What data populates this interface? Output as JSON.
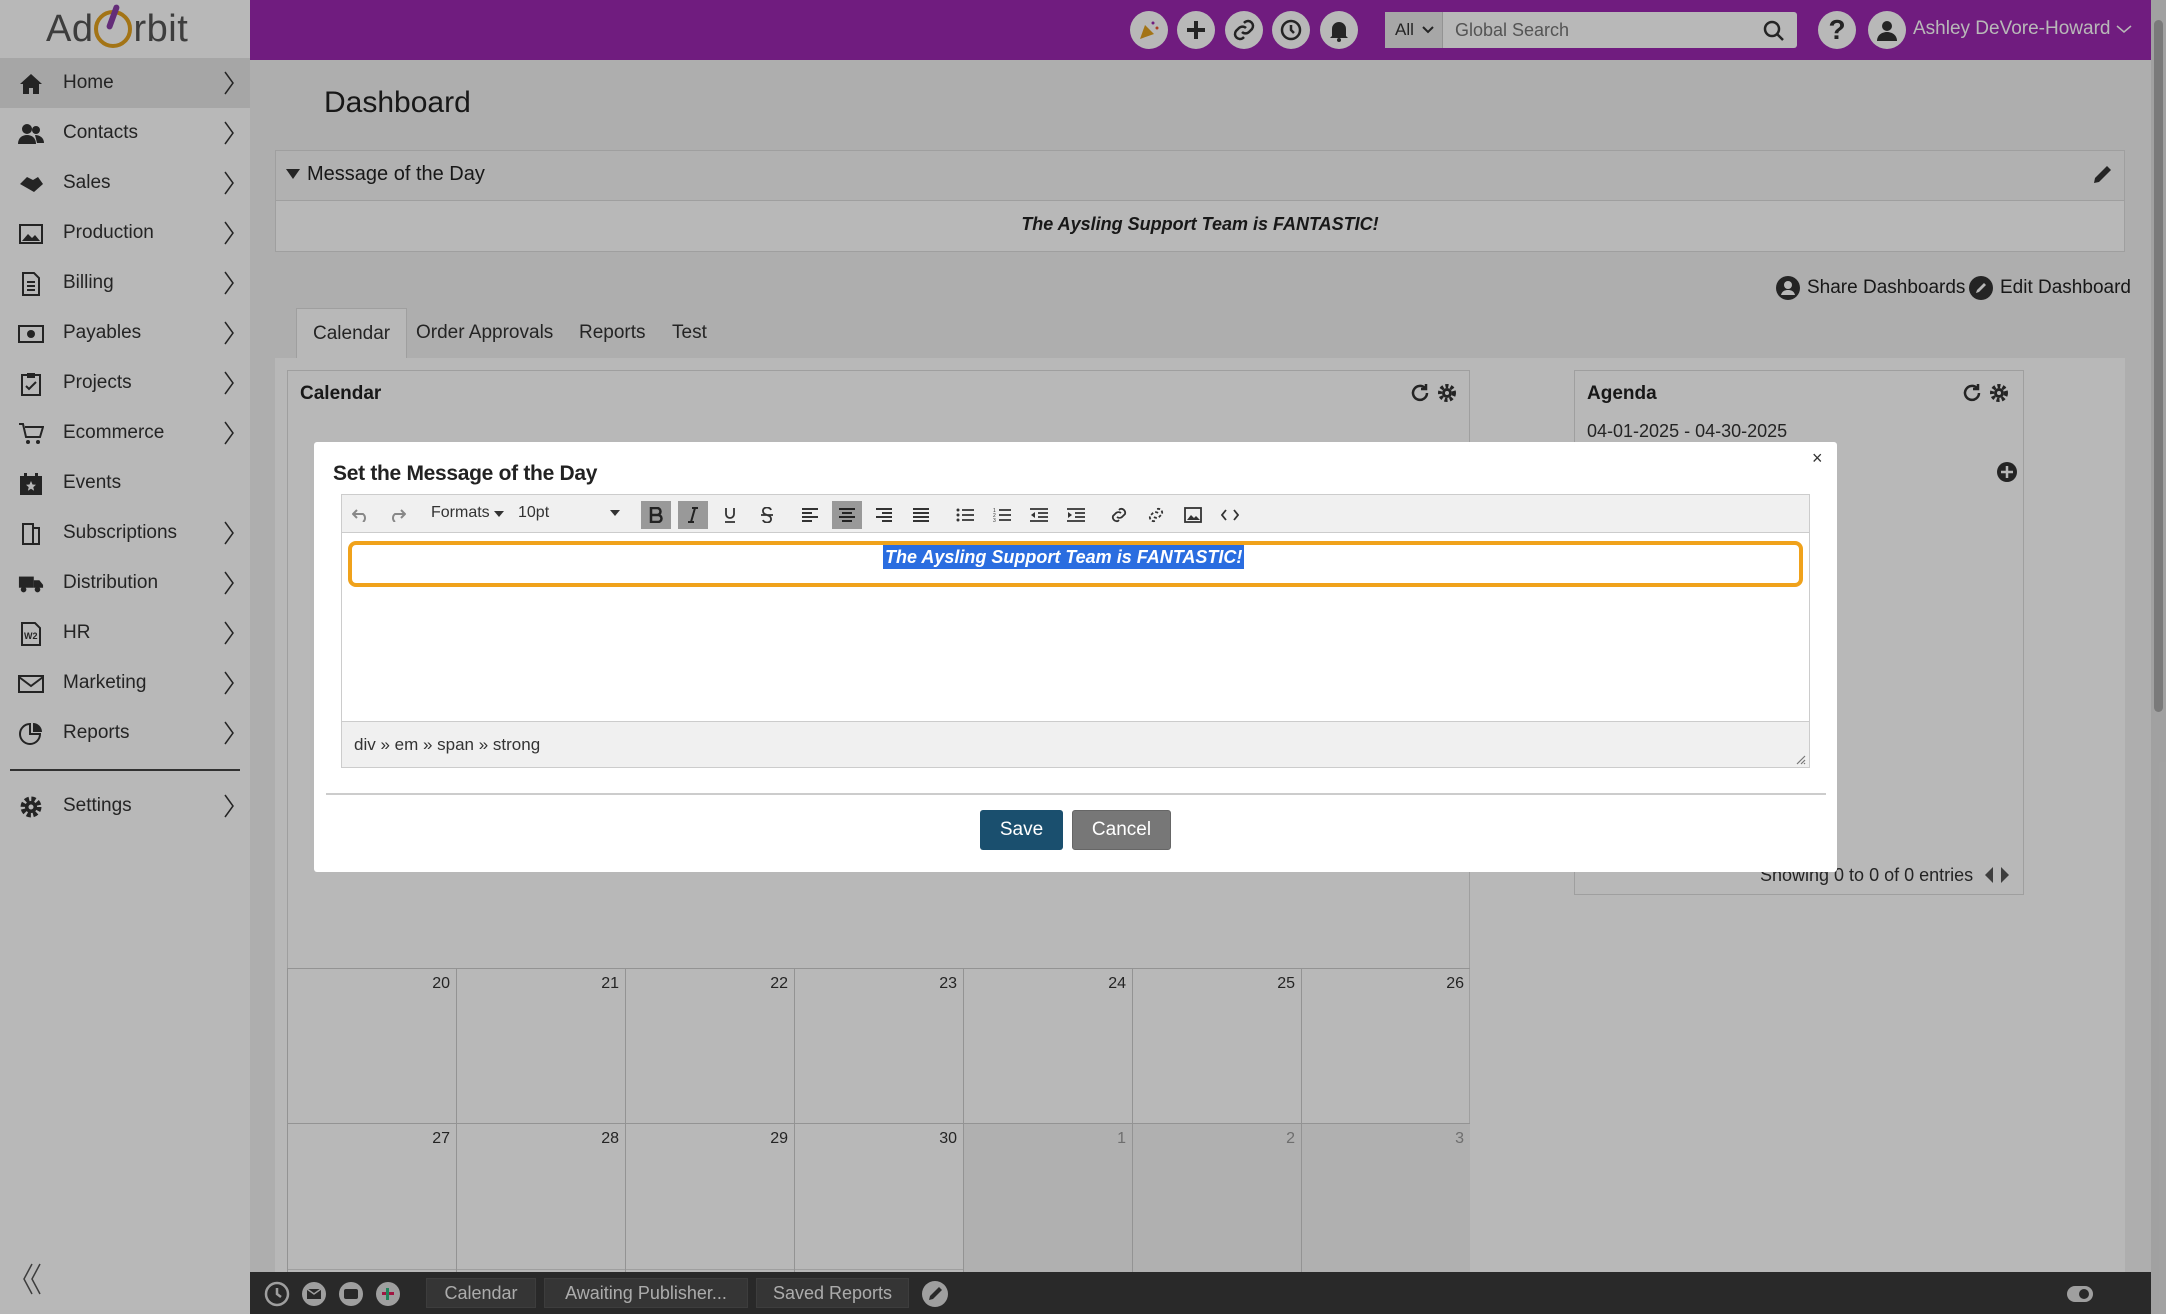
{
  "app": {
    "logo": "Ad Orbit"
  },
  "sidebar": {
    "items": [
      {
        "label": "Home",
        "icon": "home-icon"
      },
      {
        "label": "Contacts",
        "icon": "contacts-icon"
      },
      {
        "label": "Sales",
        "icon": "sales-icon"
      },
      {
        "label": "Production",
        "icon": "production-icon"
      },
      {
        "label": "Billing",
        "icon": "billing-icon"
      },
      {
        "label": "Payables",
        "icon": "payables-icon"
      },
      {
        "label": "Projects",
        "icon": "projects-icon"
      },
      {
        "label": "Ecommerce",
        "icon": "cart-icon"
      },
      {
        "label": "Events",
        "icon": "calendar-icon"
      },
      {
        "label": "Subscriptions",
        "icon": "subscriptions-icon"
      },
      {
        "label": "Distribution",
        "icon": "truck-icon"
      },
      {
        "label": "HR",
        "icon": "w2-icon"
      },
      {
        "label": "Marketing",
        "icon": "mail-icon"
      },
      {
        "label": "Reports",
        "icon": "reports-icon"
      },
      {
        "label": "Settings",
        "icon": "gear-icon"
      }
    ]
  },
  "topbar": {
    "search_scope": "All",
    "search_placeholder": "Global Search",
    "user_name": "Ashley DeVore-Howard"
  },
  "page": {
    "title": "Dashboard",
    "motd_title": "Message of the Day",
    "motd_text": "The Aysling Support Team is FANTASTIC!",
    "share_label": "Share Dashboards",
    "edit_label": "Edit Dashboard",
    "tabs": [
      "Calendar",
      "Order Approvals",
      "Reports",
      "Test"
    ]
  },
  "calendar": {
    "title": "Calendar",
    "rows": [
      [
        "20",
        "21",
        "22",
        "23",
        "24",
        "25",
        "26"
      ],
      [
        "27",
        "28",
        "29",
        "30",
        "1",
        "2",
        "3"
      ]
    ]
  },
  "agenda": {
    "title": "Agenda",
    "range": "04-01-2025 - 04-30-2025",
    "entries": "Showing 0 to 0 of 0 entries"
  },
  "modal": {
    "title": "Set the Message of the Day",
    "close": "×",
    "formats_label": "Formats",
    "font_size": "10pt",
    "content": "The Aysling Support Team is FANTASTIC!",
    "path": "div » em » span » strong",
    "save": "Save",
    "cancel": "Cancel"
  },
  "bottombar": {
    "tabs": [
      "Calendar",
      "Awaiting Publisher...",
      "Saved Reports"
    ]
  },
  "colors": {
    "topbar": "#9c27b0",
    "save": "#1a4f6e",
    "highlight": "#f0a21b",
    "selection": "#2a6de0"
  }
}
